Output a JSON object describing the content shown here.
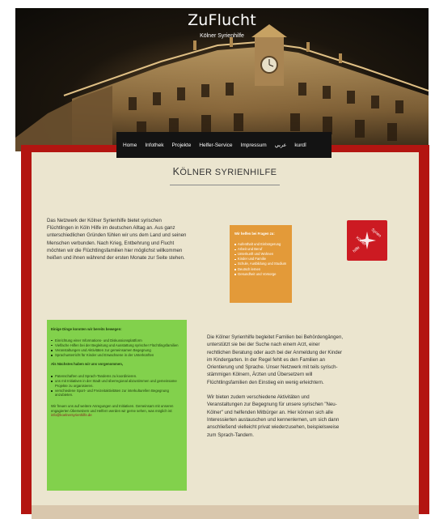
{
  "site": {
    "title": "ZuFlucht",
    "subtitle": "Kölner Syrienhilfe"
  },
  "nav": {
    "items": [
      "Home",
      "Infothek",
      "Projekte",
      "Helfer-Service",
      "Impressum",
      "عربي",
      "kurdî"
    ]
  },
  "page": {
    "title_initial": "K",
    "title_rest": "ÖLNER SYRIENHILFE"
  },
  "intro": {
    "text": "Das Netzwerk der Kölner Syrienhilfe bietet syrischen Flüchtlingen in Köln Hilfe im deutschen Alltag an. Aus ganz unterschiedlichen Gründen fühlen wir uns dem Land und seinen Menschen verbunden. Nach Krieg, Entbehrung und Flucht möchten wir die Flüchtlingsfamilien hier möglichst willkommen heißen und ihnen während der ersten Monate zur Seite stehen."
  },
  "help_box": {
    "heading": "Wir helfen bei Fragen zu:",
    "items": [
      "Aufenthalt und Einbürgerung",
      "Arbeit und Beruf",
      "Unterkunft und Wohnen",
      "Kinder und Familie",
      "Schule, Ausbildung und Studium",
      "Deutsch lernen",
      "Gesundheit und Vorsorge"
    ]
  },
  "logo": {
    "text_left": "Kölner",
    "text_right": "Syrien",
    "text_bottom": "hilfe",
    "color": "#cc1a22"
  },
  "progress_box": {
    "heading": "Einige Dinge konnten wir bereits bewegen:",
    "done_items": [
      "Einrichtung einer Informations- und Diskussionsplattform",
      "Vielfache Hilfen bei der Begleitung und Ausstattung syrischer Flüchtlingsfamilien",
      "Veranstaltungen und Aktivitäten zur gemeinsamen Begegnung",
      "Sprachunterricht für Kinder und Erwachsene in der Unterkünften"
    ],
    "next_heading": "Als Nächstes haben wir uns vorgenommen,",
    "next_items": [
      "Patenschaften und Sprach-Tandems zu koordinieren.",
      "uns mit Initiativen in der Stadt und überregional abzustimmen und gemeinsame Projekte zu organisieren.",
      "verschiedene Sport- und Freizeitaktivitäten zur interkulturellen Begegnung anzubieten."
    ],
    "closing": "Wir freuen uns auf weitere Anregungen und Initiativen. Gemeinsam mit unseren engagierten Übersetzern und Helfern werden wir gerne sehen, was möglich ist:",
    "email": "info@koelnersyrienhilfe.de"
  },
  "right_text": {
    "paragraph1": "Die Kölner Syrienhilfe begleitet Familien bei Behördengängen, unterstützt sie bei der Suche nach einem Arzt, einer rechtlichen Beratung oder auch bei der Anmeldung der Kinder im Kindergarten. In der Regel fehlt es den Familien an Orientierung und Sprache. Unser Netzwerk mit teils syrisch-stämmigen Kölnern, Ärzten und Übersetzern will Flüchtlingsfamilien den Einstieg ein wenig erleichtern.",
    "paragraph2": "Wir bieten zudem verschiedene Aktivitäten und Veranstaltungen zur Begegnung für unsere syrischen \"Neu-Kölner\" und helfenden Mitbürger an. Hier können sich alle Interessierten austauschen und kennenlernen, um sich dann anschließend vielleicht privat wiederzusehen, beispielsweise zum Sprach-Tandem."
  },
  "colors": {
    "frame_red": "#b31511",
    "content_beige": "#ebe5cf",
    "orange": "#e39a39",
    "green": "#82d14c",
    "nav_black": "#131313"
  }
}
